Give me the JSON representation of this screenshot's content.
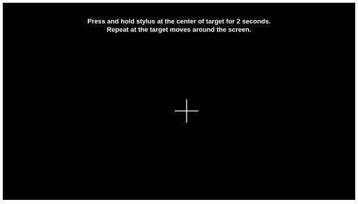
{
  "calibration": {
    "instruction_line_1": "Press and hold stylus at the center of target for 2 seconds.",
    "instruction_line_2": "Repeat at the target moves around the screen.",
    "target_icon": "crosshair-icon",
    "background_color": "#000000",
    "text_color": "#ffffff"
  }
}
